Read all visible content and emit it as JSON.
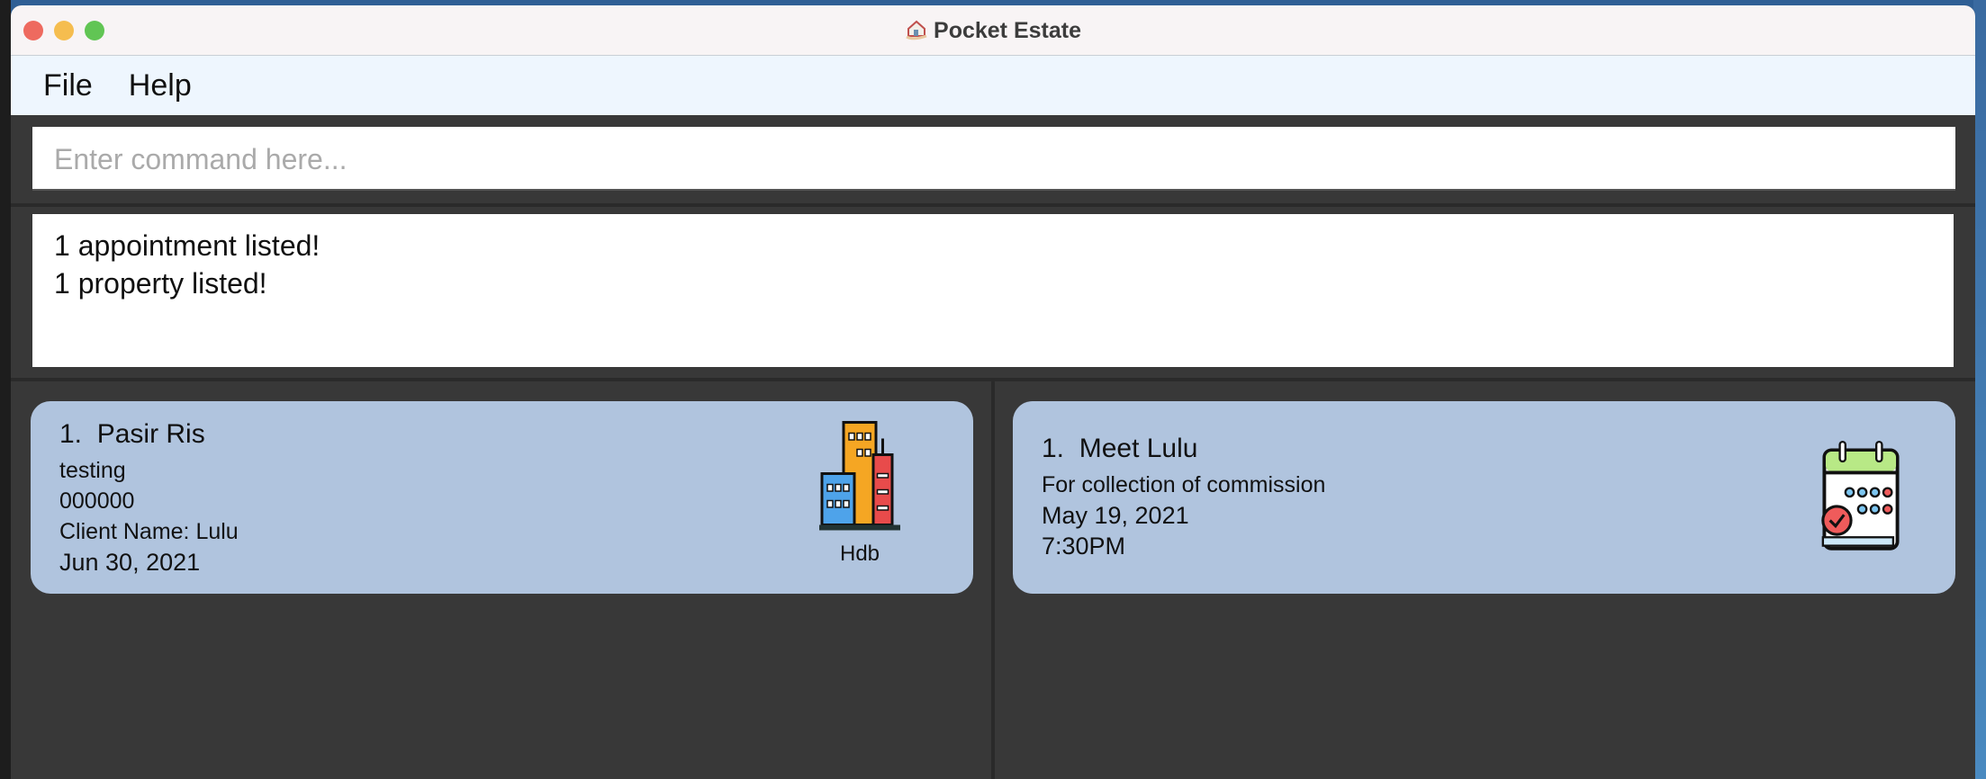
{
  "window": {
    "title": "Pocket Estate"
  },
  "menu": {
    "items": [
      "File",
      "Help"
    ]
  },
  "command": {
    "placeholder": "Enter command here...",
    "value": ""
  },
  "result": {
    "lines": [
      "1 appointment listed!",
      "1 property listed!"
    ]
  },
  "property": {
    "index": "1.",
    "name": "Pasir Ris",
    "address": "testing",
    "postal": "000000",
    "client": "Client Name: Lulu",
    "deadline": "Jun 30, 2021",
    "type": "Hdb"
  },
  "appointment": {
    "index": "1.",
    "name": "Meet Lulu",
    "remarks": "For collection of commission",
    "date": "May 19, 2021",
    "time": "7:30PM"
  },
  "colors": {
    "card": "#b0c4de",
    "panel": "#383838",
    "menu": "#eef6fe"
  }
}
